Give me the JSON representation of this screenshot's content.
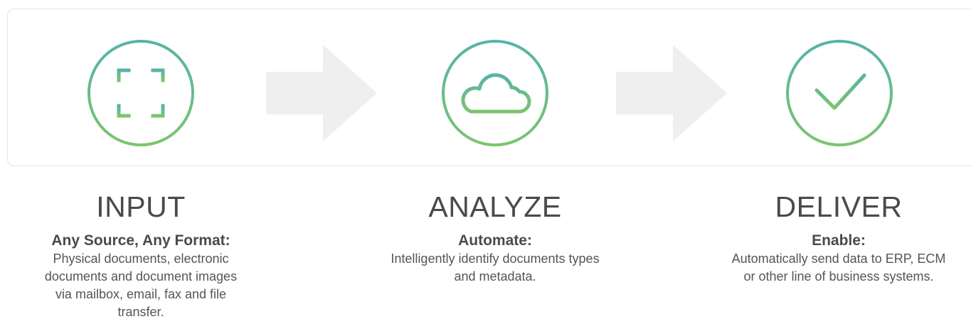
{
  "colors": {
    "gradient_top": "#56b3a8",
    "gradient_bottom": "#7cc46e",
    "arrow_fill": "#efefef",
    "panel_border": "#e6e6e6",
    "text": "#4a4a4a"
  },
  "steps": [
    {
      "icon": "scan-frame-icon",
      "title": "INPUT",
      "subtitle": "Any Source, Any Format:",
      "description": "Physical documents, electronic documents and document images via mailbox, email, fax and file transfer."
    },
    {
      "icon": "cloud-icon",
      "title": "ANALYZE",
      "subtitle": "Automate:",
      "description": "Intelligently identify documents types and metadata."
    },
    {
      "icon": "checkmark-icon",
      "title": "DELIVER",
      "subtitle": "Enable:",
      "description": "Automatically send data to ERP, ECM or other line of business systems."
    }
  ]
}
